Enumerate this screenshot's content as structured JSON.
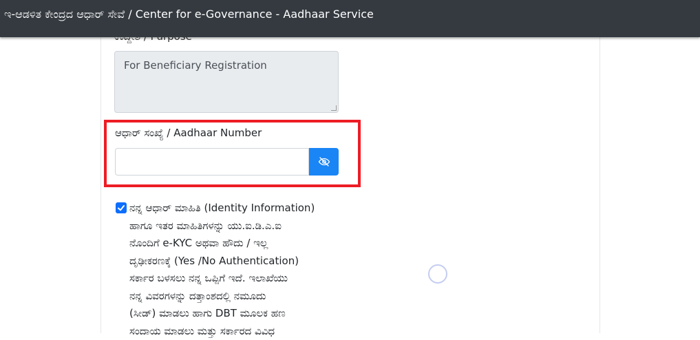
{
  "header": {
    "title": "ಇ-ಆಡಳಿತ ಕೇಂದ್ರದ ಆಧಾರ್ ಸೇವೆ / Center for e-Governance - Aadhaar Service"
  },
  "purpose": {
    "label": "ಉದ್ದೇಶ / Purpose",
    "value": "For Beneficiary Registration"
  },
  "aadhaar": {
    "label": "ಆಧಾರ್ ಸಂಖ್ಯೆ / Aadhaar Number",
    "value": "",
    "placeholder": "",
    "toggle_icon": "eye-slash-icon"
  },
  "consent": {
    "checked": true,
    "lines": [
      "ನನ್ನ ಆಧಾರ್ ಮಾಹಿತಿ (Identity Information)",
      "ಹಾಗೂ ಇತರ ಮಾಹಿತಿಗಳನ್ನು ಯು.ಐ.ಡಿ.ಎ.ಐ",
      "ನೊಂದಿಗೆ e-KYC ಅಥವಾ ಹೌದು / ಇಲ್ಲ",
      "ದೃಢೀಕರಣಕ್ಕೆ (Yes /No Authentication)",
      "ಸರ್ಕಾರ ಬಳಸಲು ನನ್ನ ಒಪ್ಪಿಗೆ ಇದೆ. ಇಲಾಖೆಯು",
      "ನನ್ನ ವಿವರಗಳನ್ನು ದತ್ತಾಂಶದಲ್ಲಿ ನಮೂದು",
      "(ಸೀಡ್) ಮಾಡಲು ಹಾಗು DBT ಮೂಲಕ ಹಣ",
      "ಸಂದಾಯ ಮಾಡಲು ಮತ್ತು ಸರ್ಕಾರದ ವಿವಿಧ"
    ]
  },
  "colors": {
    "header_bg": "#343a40",
    "accent": "#1a85f5",
    "highlight": "#ee1c25"
  }
}
